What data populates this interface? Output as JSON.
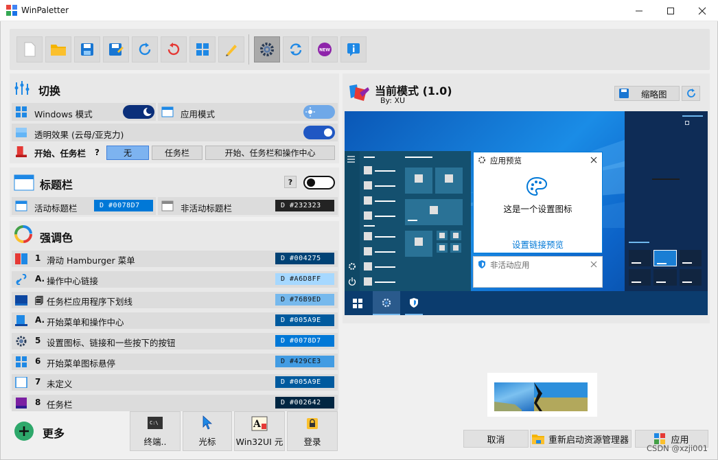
{
  "window": {
    "title": "WinPaletter"
  },
  "toggles_section": {
    "title": "切换",
    "windows_mode": "Windows 模式",
    "app_mode": "应用模式",
    "transparency": "透明效果 (云母/亚克力)",
    "start_taskbar": "开始、任务栏",
    "help": "?",
    "options": [
      "无",
      "任务栏",
      "开始、任务栏和操作中心"
    ]
  },
  "titlebar_section": {
    "title": "标题栏",
    "help": "?",
    "active_label": "活动标题栏",
    "active_color": "D #0078D7",
    "inactive_label": "非活动标题栏",
    "inactive_color": "D #232323"
  },
  "accent_section": {
    "title": "强调色",
    "items": [
      {
        "num": "1",
        "label": "滑动 Hamburger 菜单",
        "color": "D #004275",
        "bg": "#004275",
        "fg": "#ffffff"
      },
      {
        "num": "A.",
        "label": "操作中心链接",
        "color": "D #A6D8FF",
        "bg": "#a6d8ff",
        "fg": "#111111"
      },
      {
        "num": "🗐",
        "label": "任务栏应用程序下划线",
        "color": "D #76B9ED",
        "bg": "#76b9ed",
        "fg": "#111111"
      },
      {
        "num": "A.",
        "label": "开始菜单和操作中心",
        "color": "D #005A9E",
        "bg": "#005a9e",
        "fg": "#ffffff"
      },
      {
        "num": "5",
        "label": "设置图标、链接和一些按下的按钮",
        "color": "D #0078D7",
        "bg": "#0078d7",
        "fg": "#ffffff"
      },
      {
        "num": "6",
        "label": "开始菜单图标悬停",
        "color": "D #429CE3",
        "bg": "#429ce3",
        "fg": "#111111"
      },
      {
        "num": "7",
        "label": "未定义",
        "color": "D #005A9E",
        "bg": "#005a9e",
        "fg": "#ffffff"
      },
      {
        "num": "8",
        "label": "任务栏",
        "color": "D #002642",
        "bg": "#002642",
        "fg": "#ffffff"
      }
    ]
  },
  "more": {
    "label": "更多",
    "terminal": "终端..",
    "cursor": "光标",
    "win32ui": "Win32UI 元",
    "login": "登录"
  },
  "preview": {
    "title": "当前模式 (1.0)",
    "author": "By: XU",
    "thumbnail_button": "缩略图",
    "settings_window_title": "应用预览",
    "settings_text": "这是一个设置图标",
    "settings_link": "设置链接预览",
    "inactive_window_title": "非活动应用"
  },
  "actions": {
    "cancel": "取消",
    "restart_explorer": "重新启动资源管理器",
    "apply": "应用"
  },
  "watermark": "CSDN @xzji001"
}
